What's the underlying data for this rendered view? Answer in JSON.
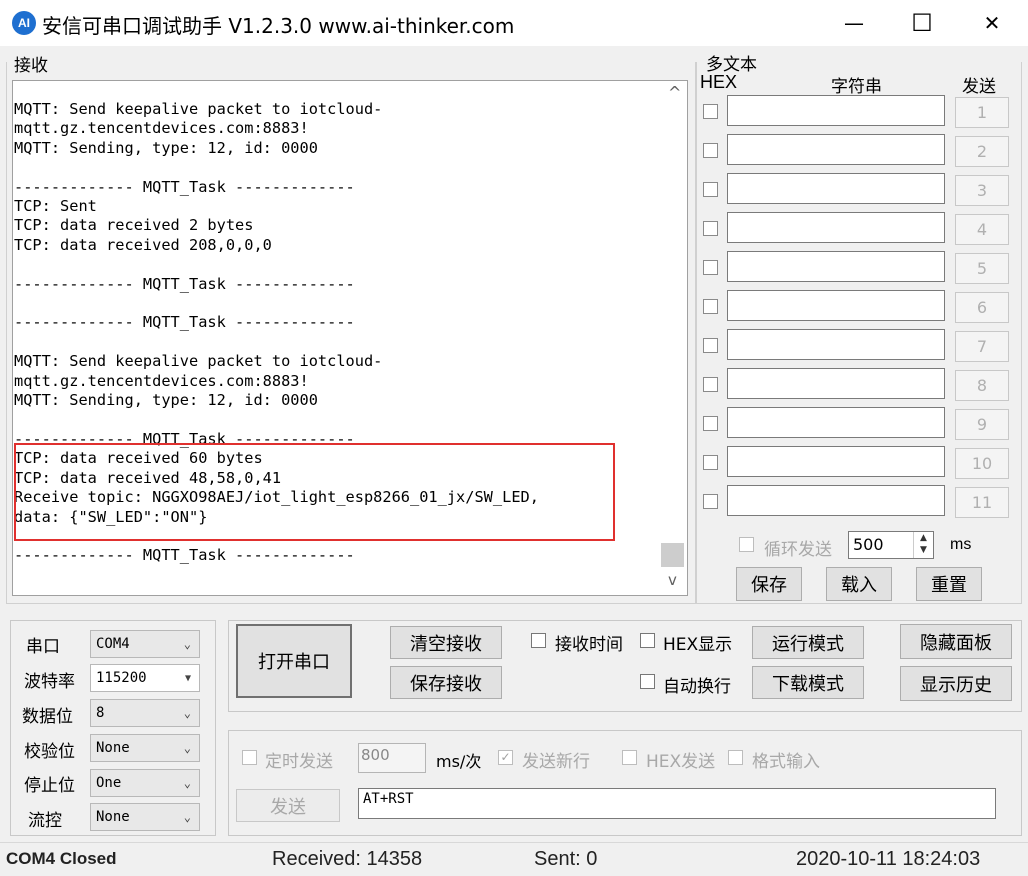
{
  "window": {
    "icon_text": "AI",
    "title": "安信可串口调试助手 V1.2.3.0    www.ai-thinker.com",
    "minimize": "—",
    "maximize": "☐",
    "close": "✕"
  },
  "receive": {
    "group_label": "接收",
    "log": "MQTT: Send keepalive packet to iotcloud-\nmqtt.gz.tencentdevices.com:8883!\nMQTT: Sending, type: 12, id: 0000\n\n------------- MQTT_Task -------------\nTCP: Sent\nTCP: data received 2 bytes\nTCP: data received 208,0,0,0\n\n------------- MQTT_Task -------------\n\n------------- MQTT_Task -------------\n\nMQTT: Send keepalive packet to iotcloud-\nmqtt.gz.tencentdevices.com:8883!\nMQTT: Sending, type: 12, id: 0000\n\n------------- MQTT_Task -------------\nTCP: data received 60 bytes\nTCP: data received 48,58,0,41\nReceive topic: NGGXO98AEJ/iot_light_esp8266_01_jx/SW_LED,\ndata: {\"SW_LED\":\"ON\"}\n\n------------- MQTT_Task -------------",
    "scroll_up": "^",
    "scroll_down": "v"
  },
  "multi_text": {
    "group_label": "多文本",
    "col_hex": "HEX",
    "col_string": "字符串",
    "col_send": "发送",
    "rows": [
      "1",
      "2",
      "3",
      "4",
      "5",
      "6",
      "7",
      "8",
      "9",
      "10",
      "11"
    ],
    "loop_send_label": "循环发送",
    "loop_interval": "500",
    "loop_unit": "ms",
    "save": "保存",
    "load": "载入",
    "reset": "重置"
  },
  "serial": {
    "port_label": "串口",
    "port_value": "COM4",
    "baud_label": "波特率",
    "baud_value": "115200",
    "databits_label": "数据位",
    "databits_value": "8",
    "parity_label": "校验位",
    "parity_value": "None",
    "stopbits_label": "停止位",
    "stopbits_value": "One",
    "flow_label": "流控",
    "flow_value": "None"
  },
  "controls": {
    "open_port": "打开串口",
    "clear_receive": "清空接收",
    "save_receive": "保存接收",
    "recv_time": "接收时间",
    "hex_display": "HEX显示",
    "run_mode": "运行模式",
    "hide_panel": "隐藏面板",
    "auto_wrap": "自动换行",
    "download_mode": "下载模式",
    "show_history": "显示历史"
  },
  "send": {
    "timed_send": "定时发送",
    "interval": "800",
    "interval_unit": "ms/次",
    "send_newline": "发送新行",
    "hex_send": "HEX发送",
    "format_input": "格式输入",
    "send_button": "发送",
    "input_value": "AT+RST"
  },
  "status": {
    "port_status": "COM4 Closed",
    "received": "Received: 14358",
    "sent": "Sent: 0",
    "datetime": "2020-10-11 18:24:03"
  }
}
